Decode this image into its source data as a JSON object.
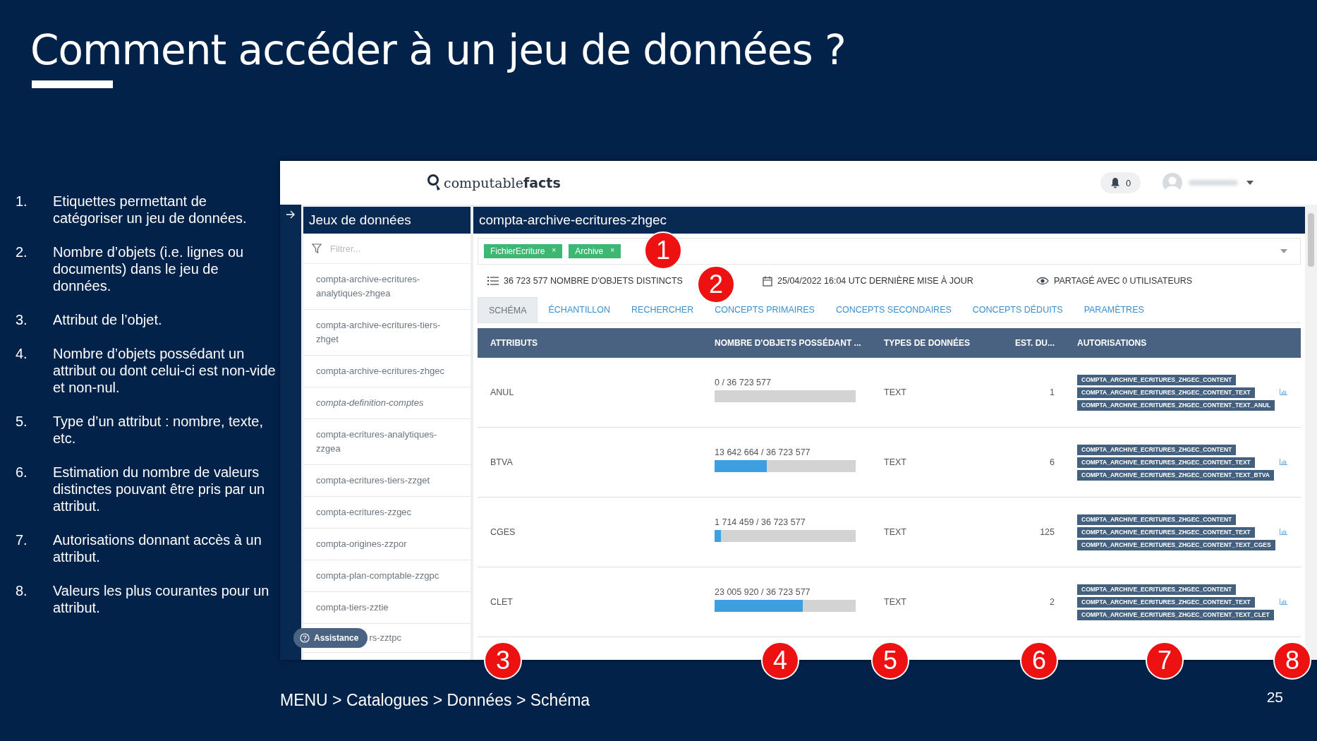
{
  "slide": {
    "title": "Comment accéder à un jeu de données ?",
    "notes": [
      {
        "number": "1.",
        "text": "Etiquettes permettant de catégoriser un jeu de données."
      },
      {
        "number": "2.",
        "text": "Nombre d’objets (i.e. lignes ou documents) dans le jeu de données."
      },
      {
        "number": "3.",
        "text": "Attribut de l’objet."
      },
      {
        "number": "4.",
        "text": "Nombre d’objets possédant un attribut ou dont celui-ci est non-vide et non-nul."
      },
      {
        "number": "5.",
        "text": "Type d’un attribut : nombre, texte, etc."
      },
      {
        "number": "6.",
        "text": "Estimation du nombre de valeurs distinctes pouvant être pris par un attribut."
      },
      {
        "number": "7.",
        "text": "Autorisations donnant accès à un attribut."
      },
      {
        "number": "8.",
        "text": "Valeurs les plus courantes pour un attribut."
      }
    ],
    "breadcrumb": "MENU > Catalogues > Données > Schéma",
    "page_number": "25"
  },
  "app": {
    "logo": "computable**facts**",
    "notifications": "0",
    "sidebar": {
      "title": "Jeux de données",
      "filter_placeholder": "Filtrer...",
      "items": [
        {
          "label": "compta-archive-ecritures-analytiques-zhgea",
          "italic": false
        },
        {
          "label": "compta-archive-ecritures-tiers-zhget",
          "italic": false
        },
        {
          "label": "compta-archive-ecritures-zhgec",
          "italic": false
        },
        {
          "label": "compta-definition-comptes",
          "italic": true
        },
        {
          "label": "compta-ecritures-analytiques-zzgea",
          "italic": false
        },
        {
          "label": "compta-ecritures-tiers-zzget",
          "italic": false
        },
        {
          "label": "compta-ecritures-zzgec",
          "italic": false
        },
        {
          "label": "compta-origines-zzpor",
          "italic": false
        },
        {
          "label": "compta-plan-comptable-zzgpc",
          "italic": false
        },
        {
          "label": "compta-tiers-zztie",
          "italic": false
        },
        {
          "label": "rs-zztpc",
          "italic": false
        }
      ]
    },
    "assistance_button": "Assistance",
    "dataset": {
      "title": "compta-archive-ecritures-zhgec",
      "tags": [
        {
          "label": "FichierEcriture",
          "remove": "×"
        },
        {
          "label": "Archive",
          "remove": "×"
        }
      ],
      "stats": [
        {
          "kind": "count",
          "text": "36 723 577 NOMBRE D'OBJETS DISTINCTS"
        },
        {
          "kind": "date",
          "text": "25/04/2022 16:04 UTC DERNIÈRE MISE À JOUR"
        },
        {
          "kind": "shared",
          "text": "PARTAGÉ AVEC 0 UTILISATEURS"
        }
      ],
      "tabs": [
        {
          "label": "SCHÉMA",
          "selected": true
        },
        {
          "label": "ÉCHANTILLON",
          "selected": false
        },
        {
          "label": "RECHERCHER",
          "selected": false
        },
        {
          "label": "CONCEPTS PRIMAIRES",
          "selected": false
        },
        {
          "label": "CONCEPTS SECONDAIRES",
          "selected": false
        },
        {
          "label": "CONCEPTS DÉDUITS",
          "selected": false
        },
        {
          "label": "PARAMÈTRES",
          "selected": false
        }
      ],
      "table": {
        "columns": [
          "ATTRIBUTS",
          "NOMBRE D'OBJETS POSSÉDANT ...",
          "TYPES DE DONNÉES",
          "EST. DU...",
          "AUTORISATIONS"
        ],
        "rows": [
          {
            "attribute": "ANUL",
            "count": "0 / 36 723 577",
            "level": 0,
            "type": "TEXT",
            "distinct": "1",
            "authorizations": [
              "COMPTA_ARCHIVE_ECRITURES_ZHGEC_CONTENT",
              "COMPTA_ARCHIVE_ECRITURES_ZHGEC_CONTENT_TEXT",
              "COMPTA_ARCHIVE_ECRITURES_ZHGEC_CONTENT_TEXT_ANUL"
            ]
          },
          {
            "attribute": "BTVA",
            "count": "13 642 664 / 36 723 577",
            "level": 0.371,
            "type": "TEXT",
            "distinct": "6",
            "authorizations": [
              "COMPTA_ARCHIVE_ECRITURES_ZHGEC_CONTENT",
              "COMPTA_ARCHIVE_ECRITURES_ZHGEC_CONTENT_TEXT",
              "COMPTA_ARCHIVE_ECRITURES_ZHGEC_CONTENT_TEXT_BTVA"
            ]
          },
          {
            "attribute": "CGES",
            "count": "1 714 459 / 36 723 577",
            "level": 0.047,
            "type": "TEXT",
            "distinct": "125",
            "authorizations": [
              "COMPTA_ARCHIVE_ECRITURES_ZHGEC_CONTENT",
              "COMPTA_ARCHIVE_ECRITURES_ZHGEC_CONTENT_TEXT",
              "COMPTA_ARCHIVE_ECRITURES_ZHGEC_CONTENT_TEXT_CGES"
            ]
          },
          {
            "attribute": "CLET",
            "count": "23 005 920 / 36 723 577",
            "level": 0.626,
            "type": "TEXT",
            "distinct": "2",
            "authorizations": [
              "COMPTA_ARCHIVE_ECRITURES_ZHGEC_CONTENT",
              "COMPTA_ARCHIVE_ECRITURES_ZHGEC_CONTENT_TEXT",
              "COMPTA_ARCHIVE_ECRITURES_ZHGEC_CONTENT_TEXT_CLET"
            ]
          }
        ]
      }
    }
  },
  "callouts": [
    "1",
    "2",
    "3",
    "4",
    "5",
    "6",
    "7",
    "8"
  ]
}
